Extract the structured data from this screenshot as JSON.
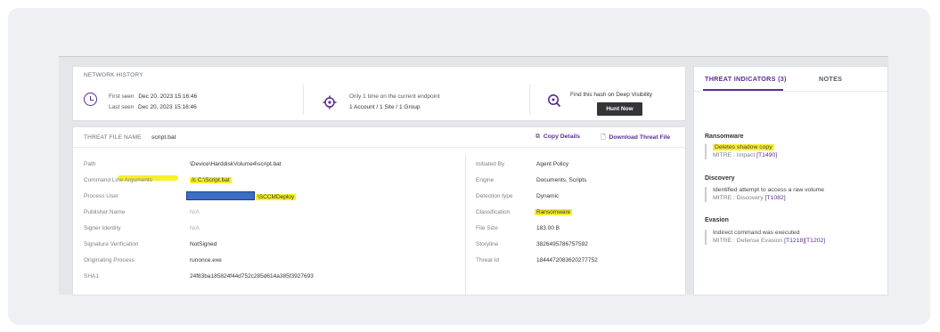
{
  "network_history": {
    "title": "NETWORK HISTORY",
    "first_seen_label": "First seen",
    "first_seen_value": "Dec 20, 2023 15:16:46",
    "last_seen_label": "Last seen",
    "last_seen_value": "Dec 20, 2023 15:16:46",
    "endpoint_line1": "Only 1 time on the current endpoint",
    "endpoint_line2": "1 Account / 1 Site / 1 Group",
    "hash_text": "Find this hash on Deep Visibility",
    "hunt_button": "Hunt Now"
  },
  "threat_file": {
    "header_label": "THREAT FILE NAME",
    "file_name": "script.bat",
    "copy_details": "Copy Details",
    "download_threat_file": "Download Threat File",
    "left_fields": [
      {
        "label": "Path",
        "value": "\\Device\\HarddiskVolume4\\script.bat"
      },
      {
        "label": "Command Line Arguments",
        "value": "/c C:\\Script.bat"
      },
      {
        "label": "Process User",
        "value": "\\SCCMDeploy"
      },
      {
        "label": "Publisher Name",
        "value": "N/A"
      },
      {
        "label": "Signer Identity",
        "value": "N/A"
      },
      {
        "label": "Signature Verification",
        "value": "NotSigned"
      },
      {
        "label": "Originating Process",
        "value": "runonce.exe"
      },
      {
        "label": "SHA1",
        "value": "24f83ba185824f44d752c285d614a385f3927693"
      }
    ],
    "right_fields": [
      {
        "label": "Initiated By",
        "value": "Agent Policy"
      },
      {
        "label": "Engine",
        "value": "Documents, Scripts"
      },
      {
        "label": "Detection type",
        "value": "Dynamic"
      },
      {
        "label": "Classification",
        "value": "Ransomware"
      },
      {
        "label": "File Size",
        "value": "183.00 B"
      },
      {
        "label": "Storyline",
        "value": "3826495786757592"
      },
      {
        "label": "Threat Id",
        "value": "1844472083620277752"
      }
    ]
  },
  "side_panel": {
    "tab_threat_indicators": "THREAT INDICATORS (3)",
    "tab_notes": "NOTES",
    "categories": [
      {
        "name": "Ransomware",
        "indicator": "Deletes shadow copy",
        "mitre": "MITRE : Impact",
        "techniques": "[T1490]"
      },
      {
        "name": "Discovery",
        "indicator": "Identified attempt to access a raw volume",
        "mitre": "MITRE : Discovery",
        "techniques": "[T1082]"
      },
      {
        "name": "Evasion",
        "indicator": "Indirect command was executed",
        "mitre": "MITRE : Defense Evasion",
        "techniques": "[T1218][T1202]"
      }
    ]
  },
  "colors": {
    "accent": "#5b2d91",
    "highlight": "#f8ef2a",
    "redaction": "#3b6fc5"
  }
}
